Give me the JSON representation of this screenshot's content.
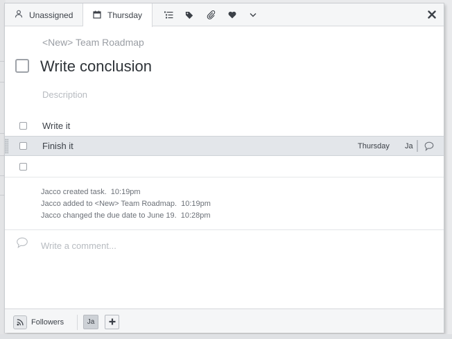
{
  "toolbar": {
    "assignee_label": "Unassigned",
    "assignee_icon": "person-icon",
    "due_label": "Thursday",
    "due_icon": "calendar-icon",
    "action_icons": [
      "subtasks-icon",
      "tag-icon",
      "paperclip-icon",
      "heart-icon",
      "chevron-down-icon"
    ],
    "close_icon": "close-icon"
  },
  "task": {
    "project": "<New> Team Roadmap",
    "title": "Write conclusion",
    "description_placeholder": "Description"
  },
  "subtasks": [
    {
      "name": "Write it",
      "due": "",
      "assignee": ""
    },
    {
      "name": "Finish it",
      "due": "Thursday",
      "assignee": "Ja"
    },
    {
      "name": "",
      "due": "",
      "assignee": ""
    }
  ],
  "activity": [
    {
      "text": "Jacco created task.",
      "time": "10:19pm"
    },
    {
      "text": "Jacco added to <New> Team Roadmap.",
      "time": "10:19pm"
    },
    {
      "text": "Jacco changed the due date to June 19.",
      "time": "10:28pm"
    }
  ],
  "comment": {
    "placeholder": "Write a comment..."
  },
  "footer": {
    "followers_label": "Followers",
    "followers_icon": "rss-icon",
    "follower_initials": "Ja",
    "add_icon": "plus-icon"
  },
  "colors": {
    "highlight_row": "#e3e6ea",
    "toolbar_bg": "#f5f6f7",
    "muted_text": "#9a9ea4"
  }
}
